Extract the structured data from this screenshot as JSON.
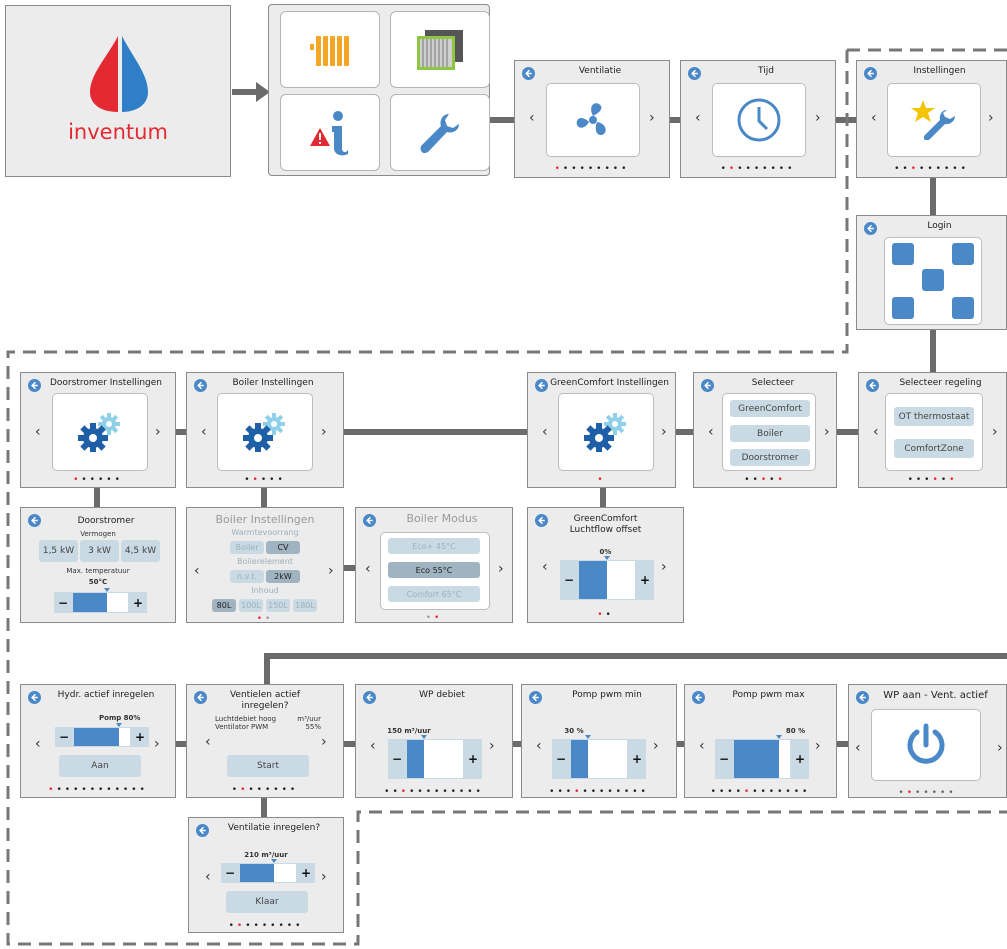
{
  "colors": {
    "accent": "#4a88c8",
    "red": "#e32a33",
    "light_blue": "#8fd0e8",
    "yellow": "#f5a623",
    "connector": "#6b6b6b"
  },
  "logo": {
    "text": "inventum"
  },
  "menu": {
    "tiles": [
      "radiator-icon",
      "filter-icon",
      "info-warning-icon",
      "wrench-icon"
    ]
  },
  "ventilatie": {
    "title": "Ventilatie"
  },
  "tijd": {
    "title": "Tijd"
  },
  "instellingen": {
    "title": "Instellingen"
  },
  "login": {
    "title": "Login"
  },
  "selecteer_regeling": {
    "title": "Selecteer regeling",
    "options": [
      "OT thermostaat",
      "ComfortZone"
    ]
  },
  "selecteer": {
    "title": "Selecteer",
    "options": [
      "GreenComfort",
      "Boiler",
      "Doorstromer"
    ]
  },
  "greencomfort_inst": {
    "title": "GreenComfort Instellingen"
  },
  "boiler_inst": {
    "title": "Boiler Instellingen"
  },
  "doorstromer_inst": {
    "title": "Doorstromer Instellingen"
  },
  "doorstromer": {
    "title": "Doorstromer",
    "vermogen_label": "Vermogen",
    "options": [
      "1,5 kW",
      "3 kW",
      "4,5 kW"
    ],
    "temp_label": "Max. temperatuur",
    "temp_value": "50°C",
    "temp_fraction": 0.62
  },
  "boiler_inst2": {
    "title": "Boiler Instellingen",
    "warmte_label": "Warmtevoorrang",
    "warmte_options": [
      "Boiler",
      "CV"
    ],
    "element_label": "Boilerelement",
    "element_options": [
      "n.v.t.",
      "2kW"
    ],
    "inhoud_label": "Inhoud",
    "inhoud_options": [
      "80L",
      "100L",
      "150L",
      "180L"
    ]
  },
  "boiler_modus": {
    "title": "Boiler Modus",
    "options": [
      "Eco+ 45°C",
      "Eco 55°C",
      "Comfort 65°C"
    ]
  },
  "luchtflow": {
    "title": "GreenComfort Luchtflow offset",
    "value": "0%",
    "fraction": 0.5
  },
  "hydr": {
    "title": "Hydr. actief inregelen",
    "value": "Pomp 80%",
    "fraction": 0.8,
    "button": "Aan"
  },
  "ventielen": {
    "title": "Ventielen actief inregelen?",
    "line1_label": "Luchtdebiet hoog",
    "line1_value": "m³/uur",
    "line2_label": "Ventilator PWM",
    "line2_value": "55%",
    "button": "Start"
  },
  "ventilatie_inregelen": {
    "title": "Ventilatie inregelen?",
    "value": "210 m³/uur",
    "fraction": 0.6,
    "button": "Klaar"
  },
  "wp_debiet": {
    "title": "WP debiet",
    "value": "150 m³/uur",
    "fraction": 0.3
  },
  "pomp_min": {
    "title": "Pomp pwm min",
    "value": "30 %",
    "fraction": 0.3
  },
  "pomp_max": {
    "title": "Pomp pwm max",
    "value": "80 %",
    "fraction": 0.8
  },
  "wp_aan": {
    "title": "WP aan - Vent. actief"
  },
  "chevrons": {
    "left": "‹",
    "right": "›"
  },
  "stepper": {
    "minus": "−",
    "plus": "+"
  }
}
